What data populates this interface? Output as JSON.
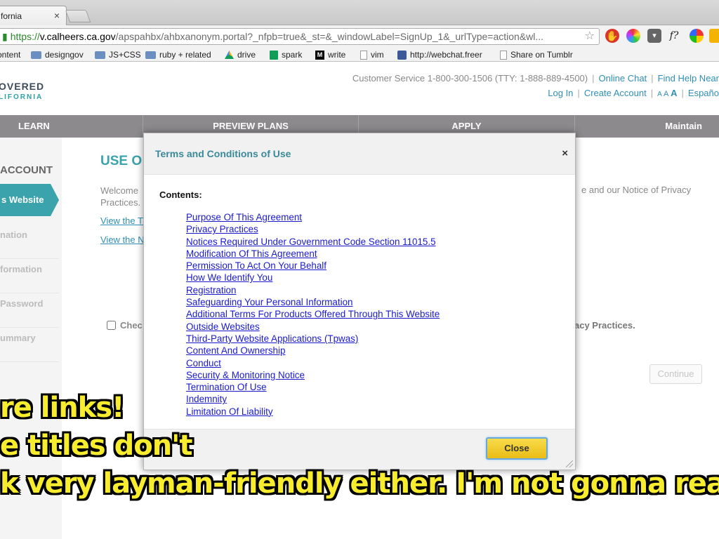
{
  "browser": {
    "tab_title": "fornia",
    "tab_close": "×",
    "url_https": "https://",
    "url_host": "v.calheers.ca.gov",
    "url_rest": "/apspahbx/ahbxanonym.portal?_nfpb=true&_st=&_windowLabel=SignUp_1&_urlType=action&wl...",
    "star": "☆",
    "extensions": [
      "hand-icon",
      "color-wheel-icon",
      "pocket-icon",
      "font-icon",
      "chrome-color-icon"
    ],
    "ext_font_label": "f?",
    "bookmarks": [
      {
        "label": "ontent",
        "icon": "page-icon"
      },
      {
        "label": "designgov",
        "icon": "folder-icon"
      },
      {
        "label": "JS+CSS",
        "icon": "folder-icon"
      },
      {
        "label": "ruby + related",
        "icon": "folder-icon"
      },
      {
        "label": "drive",
        "icon": "drive-icon"
      },
      {
        "label": "spark",
        "icon": "sheet-icon"
      },
      {
        "label": "write",
        "icon": "medium-icon"
      },
      {
        "label": "vim",
        "icon": "page-icon"
      },
      {
        "label": "http://webchat.freer",
        "icon": "web-icon"
      },
      {
        "label": "Share on Tumblr",
        "icon": "page-icon"
      }
    ]
  },
  "site": {
    "logo_line1": "OVERED",
    "logo_line2": "LIFORNIA",
    "customer_service": "Customer Service 1-800-300-1506 (TTY: 1-888-889-4500)",
    "online_chat": "Online Chat",
    "find_help": "Find Help Near",
    "log_in": "Log In",
    "create_account": "Create Account",
    "text_size": {
      "small": "A",
      "medium": "A",
      "large": "A"
    },
    "espanol": "Españo",
    "nav": [
      "LEARN",
      "PREVIEW PLANS",
      "APPLY",
      "Maintain"
    ]
  },
  "sidebar": {
    "heading": "ACCOUNT",
    "active": "s Website",
    "items": [
      "nation",
      "formation",
      "Password",
      "ummary"
    ]
  },
  "main": {
    "title": "USE O",
    "welcome_line1": "Welcome",
    "welcome_line2": "Practices.",
    "link1": "View the T",
    "link2": "View the N",
    "right_text": "e and our Notice of Privacy",
    "checkbox_label": "Chec",
    "right_bold": "acy Practices.",
    "continue": "Continue"
  },
  "modal": {
    "title": "Terms and Conditions of Use",
    "close_x": "×",
    "contents_label": "Contents:",
    "toc": [
      "Purpose Of This Agreement",
      "Privacy Practices",
      "Notices Required Under Government Code Section 11015.5",
      "Modification Of This Agreement",
      "Permission To Act On Your Behalf",
      "How We Identify You",
      "Registration",
      "Safeguarding Your Personal Information",
      "Additional Terms For Products Offered Through This Website",
      "Outside Websites",
      "Third-Party Website Applications (Tpwas)",
      "Content And Ownership",
      "Conduct",
      "Security & Monitoring Notice",
      "Termination Of Use",
      "Indemnity",
      "Limitation Of Liability"
    ],
    "close_button": "Close"
  },
  "caption": {
    "lines": [
      "re links!",
      "e titles don't",
      "k very layman-friendly either. I'm not gonna rea"
    ],
    "color": "#f7ec2e"
  }
}
